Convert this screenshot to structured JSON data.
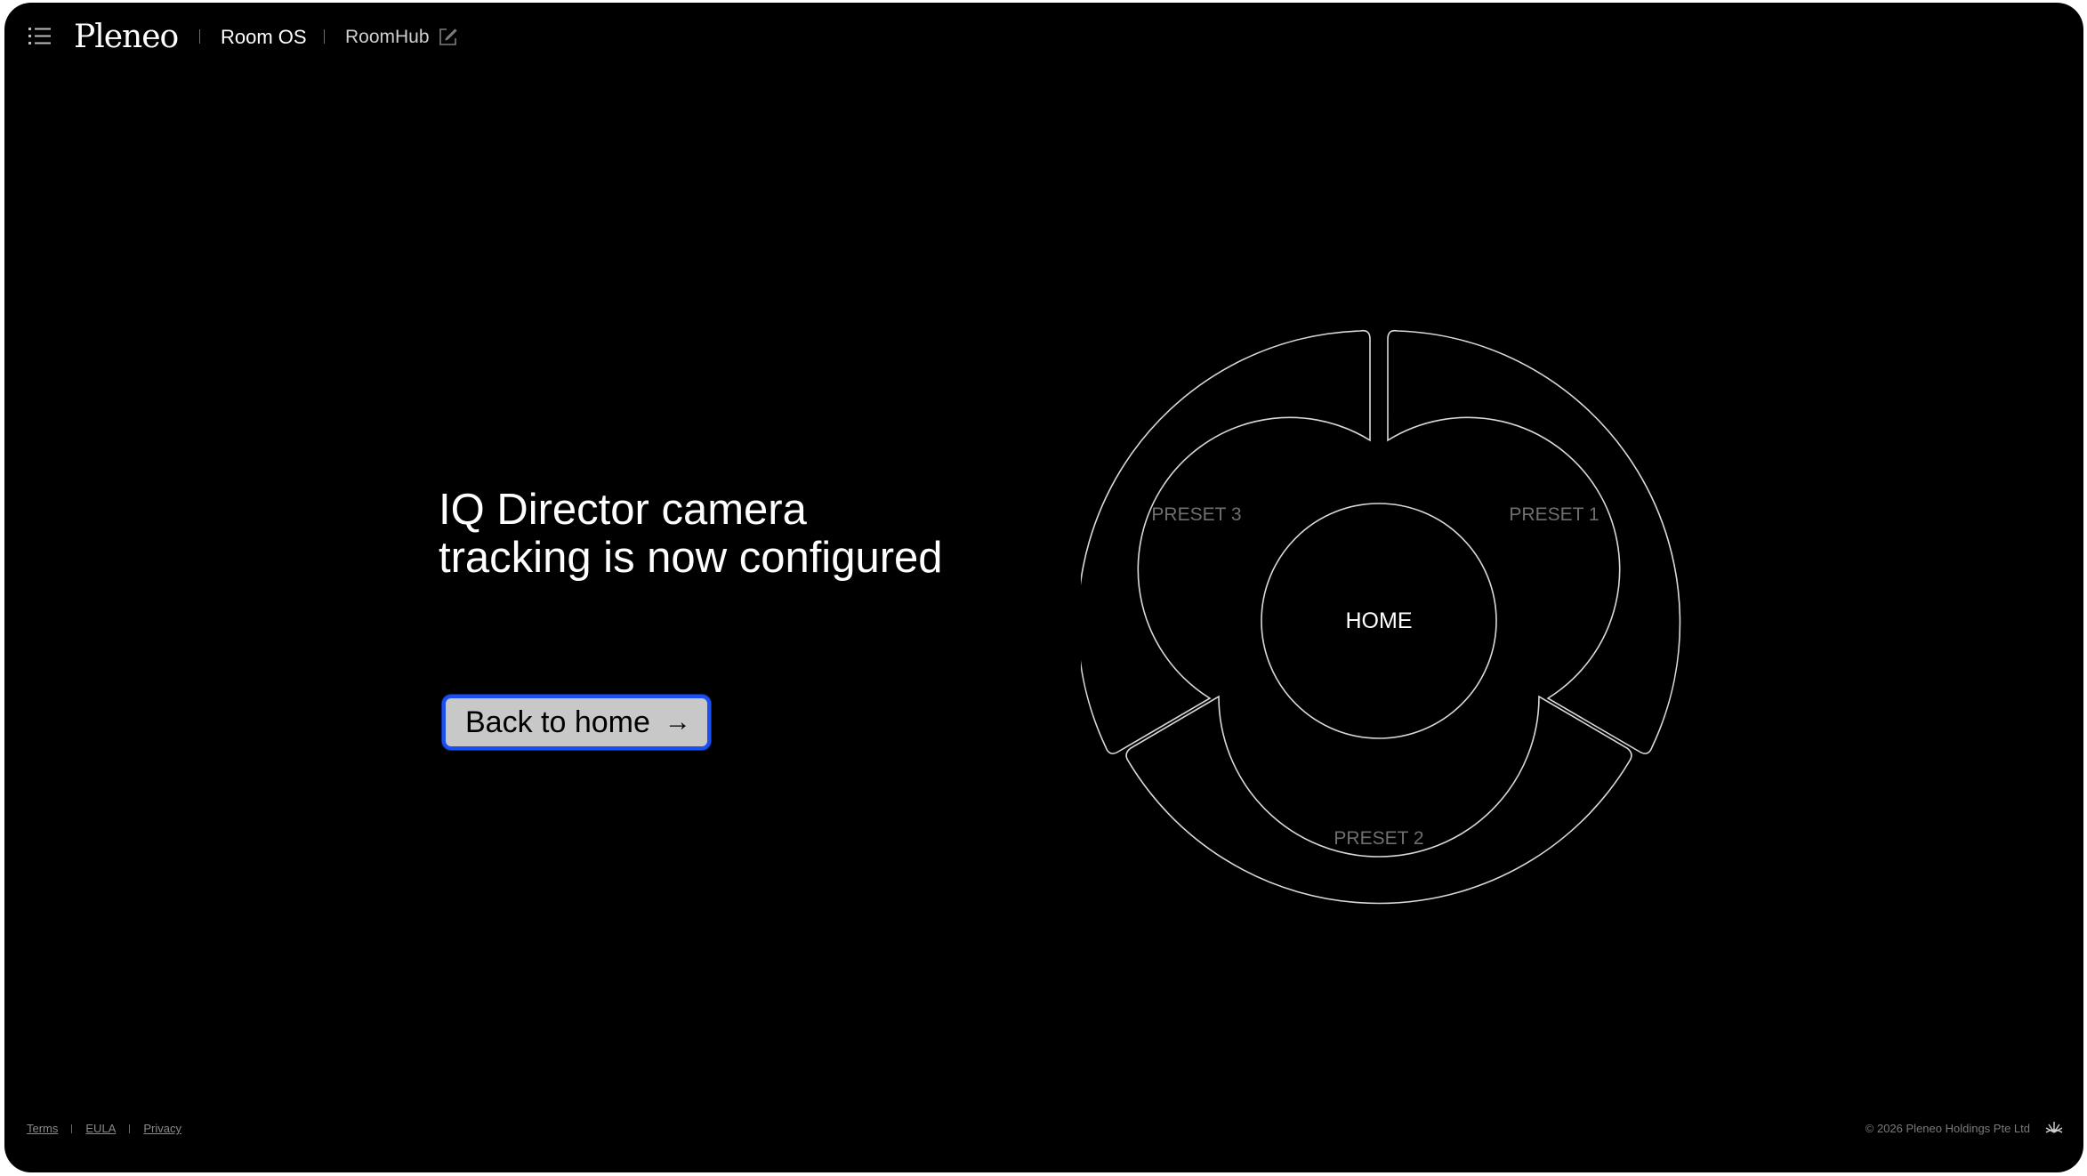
{
  "header": {
    "logo": "Pleneo",
    "breadcrumb": [
      "Room OS",
      "RoomHub"
    ]
  },
  "main": {
    "title_lines": [
      "IQ Director camera",
      "tracking is now configured"
    ],
    "back_button_label": "Back to home",
    "back_button_arrow": "→"
  },
  "wheel": {
    "center": "HOME",
    "presets": [
      "PRESET 1",
      "PRESET 2",
      "PRESET 3"
    ]
  },
  "footer": {
    "links": [
      "Terms",
      "EULA",
      "Privacy"
    ],
    "copyright": "© 2026 Pleneo Holdings Pte Ltd"
  },
  "colors": {
    "background": "#000000",
    "focus_ring": "#1a4ff0",
    "button_fill": "#c8c8c8"
  }
}
